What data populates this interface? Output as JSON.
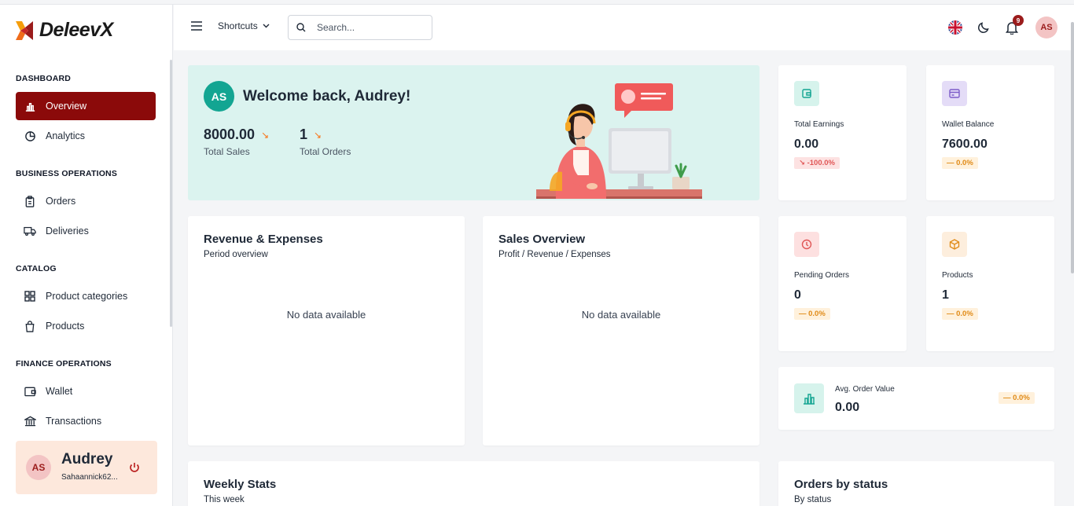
{
  "brand": {
    "name": "DeleevX"
  },
  "sidebar": {
    "sections": [
      {
        "title": "DASHBOARD"
      },
      {
        "title": "BUSINESS OPERATIONS"
      },
      {
        "title": "CATALOG"
      },
      {
        "title": "FINANCE OPERATIONS"
      }
    ],
    "items": [
      {
        "label": "Overview",
        "icon": "bar-chart-icon",
        "active": true
      },
      {
        "label": "Analytics",
        "icon": "pie-chart-icon"
      },
      {
        "label": "Orders",
        "icon": "clipboard-icon"
      },
      {
        "label": "Deliveries",
        "icon": "truck-icon"
      },
      {
        "label": "Product categories",
        "icon": "grid-icon"
      },
      {
        "label": "Products",
        "icon": "shopping-bag-icon"
      },
      {
        "label": "Wallet",
        "icon": "wallet-icon"
      },
      {
        "label": "Transactions",
        "icon": "bank-icon"
      }
    ],
    "user": {
      "initials": "AS",
      "name": "Audrey",
      "email": "Sahaannick62..."
    }
  },
  "header": {
    "shortcuts_label": "Shortcuts",
    "search_placeholder": "Search...",
    "notification_count": "9",
    "avatar_initials": "AS"
  },
  "welcome": {
    "initials": "AS",
    "title": "Welcome back, Audrey!",
    "total_sales_value": "8000.00",
    "total_sales_label": "Total Sales",
    "total_orders_value": "1",
    "total_orders_label": "Total Orders"
  },
  "stats": {
    "total_earnings": {
      "label": "Total Earnings",
      "value": "0.00",
      "change": "↘ -100.0%"
    },
    "wallet_balance": {
      "label": "Wallet Balance",
      "value": "7600.00",
      "change": "— 0.0%"
    },
    "pending_orders": {
      "label": "Pending Orders",
      "value": "0",
      "change": "— 0.0%"
    },
    "products": {
      "label": "Products",
      "value": "1",
      "change": "— 0.0%"
    },
    "avg_order_value": {
      "label": "Avg. Order Value",
      "value": "0.00",
      "change": "— 0.0%"
    }
  },
  "panels": {
    "revenue": {
      "title": "Revenue & Expenses",
      "subtitle": "Period overview",
      "empty": "No data available"
    },
    "sales": {
      "title": "Sales Overview",
      "subtitle": "Profit / Revenue / Expenses",
      "empty": "No data available"
    },
    "weekly": {
      "title": "Weekly Stats",
      "subtitle": "This week"
    },
    "orders_status": {
      "title": "Orders by status",
      "subtitle": "By status"
    }
  },
  "colors": {
    "accent": "#8b0a0a",
    "welcome_bg": "#dbf3ef",
    "teal": "#13a592",
    "badge_red": "#e05656",
    "badge_orange": "#e08a16"
  }
}
